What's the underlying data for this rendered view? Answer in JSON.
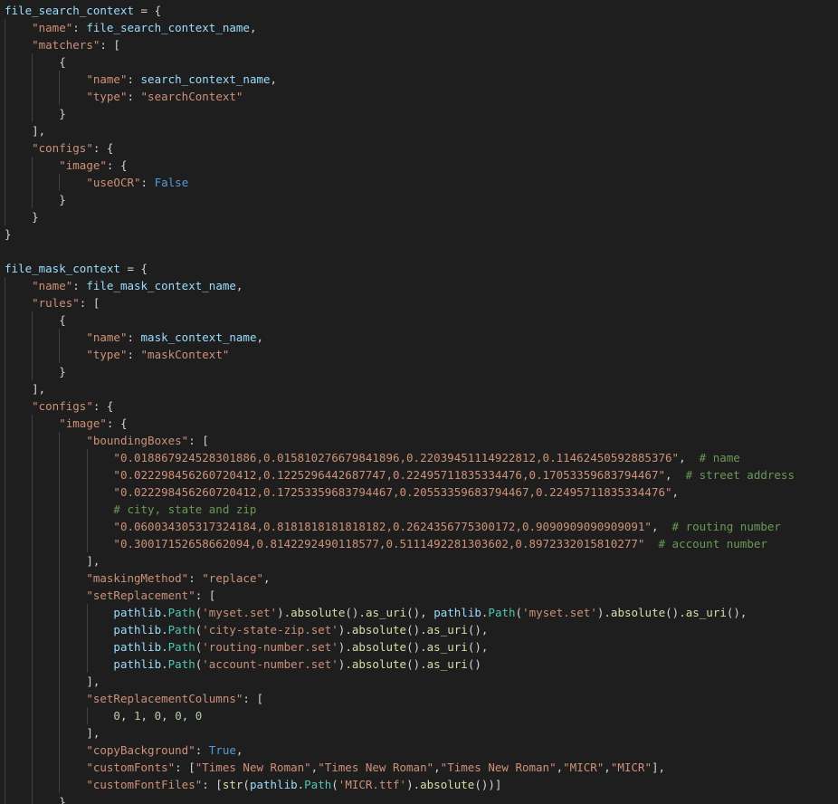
{
  "editor": {
    "theme": {
      "background": "#1e1e1e",
      "indent_guide": "#404040",
      "colors": {
        "variable": "#9cdcfe",
        "string": "#ce9178",
        "keyword": "#569cd6",
        "function": "#dcdcaa",
        "class": "#4ec9b0",
        "number": "#b5cea8",
        "comment": "#6a9955",
        "punctuation": "#d4d4d4"
      }
    },
    "lines": [
      {
        "indent": 0,
        "tokens": [
          [
            "var",
            "file_search_context"
          ],
          [
            "punc",
            " = {"
          ]
        ]
      },
      {
        "indent": 1,
        "tokens": [
          [
            "str",
            "\"name\""
          ],
          [
            "punc",
            ": "
          ],
          [
            "var",
            "file_search_context_name"
          ],
          [
            "punc",
            ","
          ]
        ]
      },
      {
        "indent": 1,
        "tokens": [
          [
            "str",
            "\"matchers\""
          ],
          [
            "punc",
            ": ["
          ]
        ]
      },
      {
        "indent": 2,
        "tokens": [
          [
            "punc",
            "{"
          ]
        ]
      },
      {
        "indent": 3,
        "tokens": [
          [
            "str",
            "\"name\""
          ],
          [
            "punc",
            ": "
          ],
          [
            "var",
            "search_context_name"
          ],
          [
            "punc",
            ","
          ]
        ]
      },
      {
        "indent": 3,
        "tokens": [
          [
            "str",
            "\"type\""
          ],
          [
            "punc",
            ": "
          ],
          [
            "str",
            "\"searchContext\""
          ]
        ]
      },
      {
        "indent": 2,
        "tokens": [
          [
            "punc",
            "}"
          ]
        ]
      },
      {
        "indent": 1,
        "tokens": [
          [
            "punc",
            "],"
          ]
        ]
      },
      {
        "indent": 1,
        "tokens": [
          [
            "str",
            "\"configs\""
          ],
          [
            "punc",
            ": {"
          ]
        ]
      },
      {
        "indent": 2,
        "tokens": [
          [
            "str",
            "\"image\""
          ],
          [
            "punc",
            ": {"
          ]
        ]
      },
      {
        "indent": 3,
        "tokens": [
          [
            "str",
            "\"useOCR\""
          ],
          [
            "punc",
            ": "
          ],
          [
            "kw",
            "False"
          ]
        ]
      },
      {
        "indent": 2,
        "tokens": [
          [
            "punc",
            "}"
          ]
        ]
      },
      {
        "indent": 1,
        "tokens": [
          [
            "punc",
            "}"
          ]
        ]
      },
      {
        "indent": 0,
        "tokens": [
          [
            "punc",
            "}"
          ]
        ]
      },
      {
        "indent": 0,
        "tokens": []
      },
      {
        "indent": 0,
        "tokens": [
          [
            "var",
            "file_mask_context"
          ],
          [
            "punc",
            " = {"
          ]
        ]
      },
      {
        "indent": 1,
        "tokens": [
          [
            "str",
            "\"name\""
          ],
          [
            "punc",
            ": "
          ],
          [
            "var",
            "file_mask_context_name"
          ],
          [
            "punc",
            ","
          ]
        ]
      },
      {
        "indent": 1,
        "tokens": [
          [
            "str",
            "\"rules\""
          ],
          [
            "punc",
            ": ["
          ]
        ]
      },
      {
        "indent": 2,
        "tokens": [
          [
            "punc",
            "{"
          ]
        ]
      },
      {
        "indent": 3,
        "tokens": [
          [
            "str",
            "\"name\""
          ],
          [
            "punc",
            ": "
          ],
          [
            "var",
            "mask_context_name"
          ],
          [
            "punc",
            ","
          ]
        ]
      },
      {
        "indent": 3,
        "tokens": [
          [
            "str",
            "\"type\""
          ],
          [
            "punc",
            ": "
          ],
          [
            "str",
            "\"maskContext\""
          ]
        ]
      },
      {
        "indent": 2,
        "tokens": [
          [
            "punc",
            "}"
          ]
        ]
      },
      {
        "indent": 1,
        "tokens": [
          [
            "punc",
            "],"
          ]
        ]
      },
      {
        "indent": 1,
        "tokens": [
          [
            "str",
            "\"configs\""
          ],
          [
            "punc",
            ": {"
          ]
        ]
      },
      {
        "indent": 2,
        "tokens": [
          [
            "str",
            "\"image\""
          ],
          [
            "punc",
            ": {"
          ]
        ]
      },
      {
        "indent": 3,
        "tokens": [
          [
            "str",
            "\"boundingBoxes\""
          ],
          [
            "punc",
            ": ["
          ]
        ]
      },
      {
        "indent": 4,
        "tokens": [
          [
            "str",
            "\"0.018867924528301886,0.015810276679841896,0.22039451114922812,0.11462450592885376\""
          ],
          [
            "punc",
            ",  "
          ],
          [
            "cmt",
            "# name"
          ]
        ]
      },
      {
        "indent": 4,
        "tokens": [
          [
            "str",
            "\"0.022298456260720412,0.1225296442687747,0.22495711835334476,0.17053359683794467\""
          ],
          [
            "punc",
            ",  "
          ],
          [
            "cmt",
            "# street address"
          ]
        ]
      },
      {
        "indent": 4,
        "tokens": [
          [
            "str",
            "\"0.022298456260720412,0.17253359683794467,0.20553359683794467,0.22495711835334476\""
          ],
          [
            "punc",
            ","
          ]
        ]
      },
      {
        "indent": 4,
        "tokens": [
          [
            "cmt",
            "# city, state and zip"
          ]
        ]
      },
      {
        "indent": 4,
        "tokens": [
          [
            "str",
            "\"0.060034305317324184,0.8181818181818182,0.2624356775300172,0.9090909090909091\""
          ],
          [
            "punc",
            ",  "
          ],
          [
            "cmt",
            "# routing number"
          ]
        ]
      },
      {
        "indent": 4,
        "tokens": [
          [
            "str",
            "\"0.30017152658662094,0.8142292490118577,0.5111492281303602,0.8972332015810277\""
          ],
          [
            "punc",
            "  "
          ],
          [
            "cmt",
            "# account number"
          ]
        ]
      },
      {
        "indent": 3,
        "tokens": [
          [
            "punc",
            "],"
          ]
        ]
      },
      {
        "indent": 3,
        "tokens": [
          [
            "str",
            "\"maskingMethod\""
          ],
          [
            "punc",
            ": "
          ],
          [
            "str",
            "\"replace\""
          ],
          [
            "punc",
            ","
          ]
        ]
      },
      {
        "indent": 3,
        "tokens": [
          [
            "str",
            "\"setReplacement\""
          ],
          [
            "punc",
            ": ["
          ]
        ]
      },
      {
        "indent": 4,
        "tokens": [
          [
            "var",
            "pathlib"
          ],
          [
            "punc",
            "."
          ],
          [
            "cls",
            "Path"
          ],
          [
            "punc",
            "("
          ],
          [
            "str",
            "'myset.set'"
          ],
          [
            "punc",
            ")."
          ],
          [
            "fn",
            "absolute"
          ],
          [
            "punc",
            "()."
          ],
          [
            "fn",
            "as_uri"
          ],
          [
            "punc",
            "(), "
          ],
          [
            "var",
            "pathlib"
          ],
          [
            "punc",
            "."
          ],
          [
            "cls",
            "Path"
          ],
          [
            "punc",
            "("
          ],
          [
            "str",
            "'myset.set'"
          ],
          [
            "punc",
            ")."
          ],
          [
            "fn",
            "absolute"
          ],
          [
            "punc",
            "()."
          ],
          [
            "fn",
            "as_uri"
          ],
          [
            "punc",
            "(),"
          ]
        ]
      },
      {
        "indent": 4,
        "tokens": [
          [
            "var",
            "pathlib"
          ],
          [
            "punc",
            "."
          ],
          [
            "cls",
            "Path"
          ],
          [
            "punc",
            "("
          ],
          [
            "str",
            "'city-state-zip.set'"
          ],
          [
            "punc",
            ")."
          ],
          [
            "fn",
            "absolute"
          ],
          [
            "punc",
            "()."
          ],
          [
            "fn",
            "as_uri"
          ],
          [
            "punc",
            "(),"
          ]
        ]
      },
      {
        "indent": 4,
        "tokens": [
          [
            "var",
            "pathlib"
          ],
          [
            "punc",
            "."
          ],
          [
            "cls",
            "Path"
          ],
          [
            "punc",
            "("
          ],
          [
            "str",
            "'routing-number.set'"
          ],
          [
            "punc",
            ")."
          ],
          [
            "fn",
            "absolute"
          ],
          [
            "punc",
            "()."
          ],
          [
            "fn",
            "as_uri"
          ],
          [
            "punc",
            "(),"
          ]
        ]
      },
      {
        "indent": 4,
        "tokens": [
          [
            "var",
            "pathlib"
          ],
          [
            "punc",
            "."
          ],
          [
            "cls",
            "Path"
          ],
          [
            "punc",
            "("
          ],
          [
            "str",
            "'account-number.set'"
          ],
          [
            "punc",
            ")."
          ],
          [
            "fn",
            "absolute"
          ],
          [
            "punc",
            "()."
          ],
          [
            "fn",
            "as_uri"
          ],
          [
            "punc",
            "()"
          ]
        ]
      },
      {
        "indent": 3,
        "tokens": [
          [
            "punc",
            "],"
          ]
        ]
      },
      {
        "indent": 3,
        "tokens": [
          [
            "str",
            "\"setReplacementColumns\""
          ],
          [
            "punc",
            ": ["
          ]
        ]
      },
      {
        "indent": 4,
        "tokens": [
          [
            "num",
            "0"
          ],
          [
            "punc",
            ", "
          ],
          [
            "num",
            "1"
          ],
          [
            "punc",
            ", "
          ],
          [
            "num",
            "0"
          ],
          [
            "punc",
            ", "
          ],
          [
            "num",
            "0"
          ],
          [
            "punc",
            ", "
          ],
          [
            "num",
            "0"
          ]
        ]
      },
      {
        "indent": 3,
        "tokens": [
          [
            "punc",
            "],"
          ]
        ]
      },
      {
        "indent": 3,
        "tokens": [
          [
            "str",
            "\"copyBackground\""
          ],
          [
            "punc",
            ": "
          ],
          [
            "kw",
            "True"
          ],
          [
            "punc",
            ","
          ]
        ]
      },
      {
        "indent": 3,
        "tokens": [
          [
            "str",
            "\"customFonts\""
          ],
          [
            "punc",
            ": ["
          ],
          [
            "str",
            "\"Times New Roman\""
          ],
          [
            "punc",
            ","
          ],
          [
            "str",
            "\"Times New Roman\""
          ],
          [
            "punc",
            ","
          ],
          [
            "str",
            "\"Times New Roman\""
          ],
          [
            "punc",
            ","
          ],
          [
            "str",
            "\"MICR\""
          ],
          [
            "punc",
            ","
          ],
          [
            "str",
            "\"MICR\""
          ],
          [
            "punc",
            "],"
          ]
        ]
      },
      {
        "indent": 3,
        "tokens": [
          [
            "str",
            "\"customFontFiles\""
          ],
          [
            "punc",
            ": ["
          ],
          [
            "fn",
            "str"
          ],
          [
            "punc",
            "("
          ],
          [
            "var",
            "pathlib"
          ],
          [
            "punc",
            "."
          ],
          [
            "cls",
            "Path"
          ],
          [
            "punc",
            "("
          ],
          [
            "str",
            "'MICR.ttf'"
          ],
          [
            "punc",
            ")."
          ],
          [
            "fn",
            "absolute"
          ],
          [
            "punc",
            "())]"
          ]
        ]
      },
      {
        "indent": 2,
        "tokens": [
          [
            "punc",
            "}"
          ]
        ]
      }
    ]
  }
}
